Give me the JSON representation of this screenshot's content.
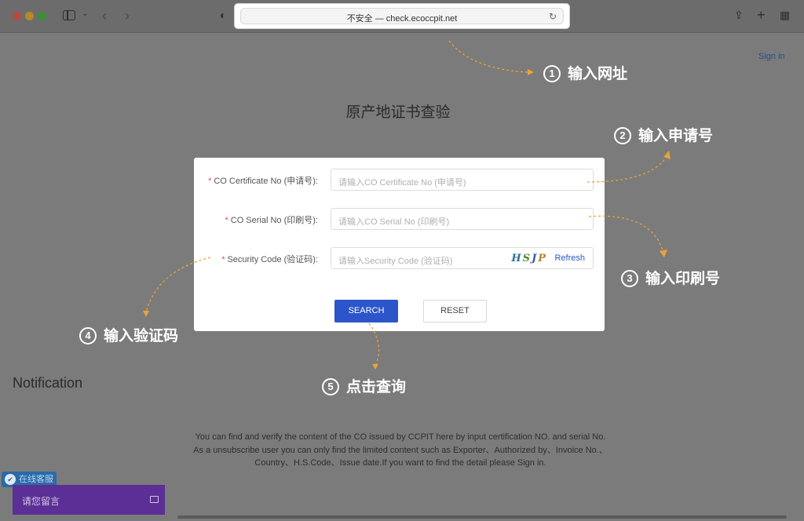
{
  "browser": {
    "address": "不安全 — check.ecoccpit.net"
  },
  "header": {
    "signin_label": "Sign in"
  },
  "page": {
    "title": "原产地证书查验"
  },
  "form": {
    "cert_label": "CO Certificate No (申请号):",
    "cert_placeholder": "请输入CO Certificate No (申请号)",
    "serial_label": "CO Serial No (印刷号):",
    "serial_placeholder": "请输入CO Serial No (印刷号)",
    "code_label": "Security Code (验证码):",
    "code_placeholder": "请输入Security Code (验证码)",
    "captcha": [
      "H",
      "S",
      "J",
      "P"
    ],
    "refresh_label": "Refresh",
    "required_mark": "*",
    "search_label": "SEARCH",
    "reset_label": "RESET"
  },
  "notification": {
    "title": "Notification",
    "lines": [
      "You can find and verify the content of the CO issued by CCPIT here by input certification NO. and serial No.",
      "As a unsubscribe user you can only find the limited content such as Exporter、Authorized by、Invoice No.、",
      "Country、H.S.Code、Issue date.If you want to find the detail please Sign in."
    ]
  },
  "annotations": [
    {
      "num": "1",
      "text": "输入网址"
    },
    {
      "num": "2",
      "text": "输入申请号"
    },
    {
      "num": "3",
      "text": "输入印刷号"
    },
    {
      "num": "4",
      "text": "输入验证码"
    },
    {
      "num": "5",
      "text": "点击查询"
    }
  ],
  "chat": {
    "badge_label": "在线客服",
    "box_label": "请您留言"
  },
  "colors": {
    "accent": "#2c55c9",
    "required": "#d9534f",
    "arrow": "#e8a33a",
    "chat": "#5b2f95"
  }
}
